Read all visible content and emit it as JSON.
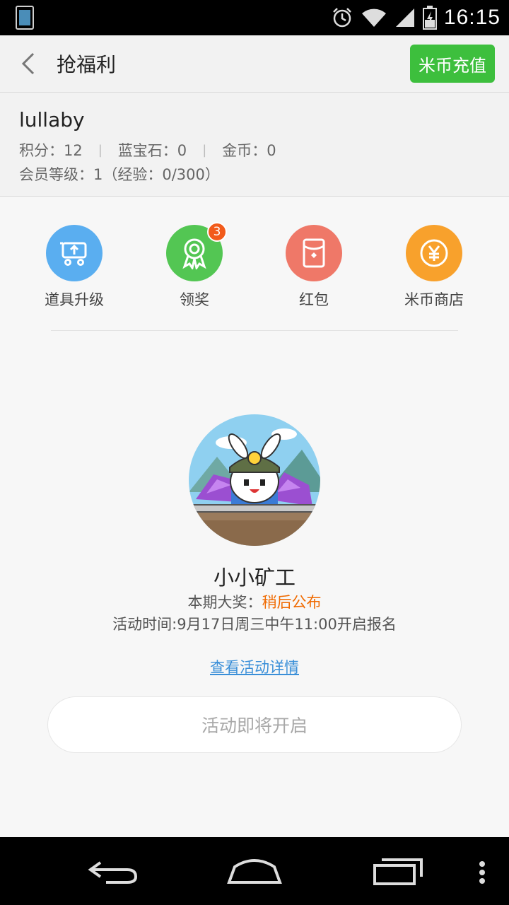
{
  "status_bar": {
    "time": "16:15",
    "icons": [
      "app-notification-icon",
      "alarm-icon",
      "wifi-icon",
      "signal-icon",
      "battery-icon"
    ]
  },
  "header": {
    "title": "抢福利",
    "recharge_label": "米币充值"
  },
  "user": {
    "name": "lullaby",
    "points_label": "积分：12",
    "sapphire_label": "蓝宝石：0",
    "gold_label": "金币：0",
    "level_label": "会员等级：1（经验：0/300）"
  },
  "features": [
    {
      "label": "道具升级",
      "icon": "cart-upgrade-icon",
      "color": "#5aaef0"
    },
    {
      "label": "领奖",
      "icon": "award-ribbon-icon",
      "color": "#53c653",
      "badge": "3"
    },
    {
      "label": "红包",
      "icon": "red-envelope-icon",
      "color": "#ef7868"
    },
    {
      "label": "米币商店",
      "icon": "yuan-coin-icon",
      "color": "#f8a12c"
    }
  ],
  "activity": {
    "title": "小小矿工",
    "prize_prefix": "本期大奖：",
    "prize_value": "稍后公布",
    "time_text": "活动时间:9月17日周三中午11:00开启报名",
    "detail_link": "查看活动详情",
    "button_label": "活动即将开启"
  },
  "colors": {
    "accent_green": "#3dbf3d",
    "prize_orange": "#f06a00",
    "link_blue": "#3a8fd8",
    "badge_orange": "#f25b1b"
  },
  "nav_bar": {
    "icons": [
      "back-nav-icon",
      "home-nav-icon",
      "recent-apps-icon",
      "overflow-menu-icon"
    ]
  }
}
